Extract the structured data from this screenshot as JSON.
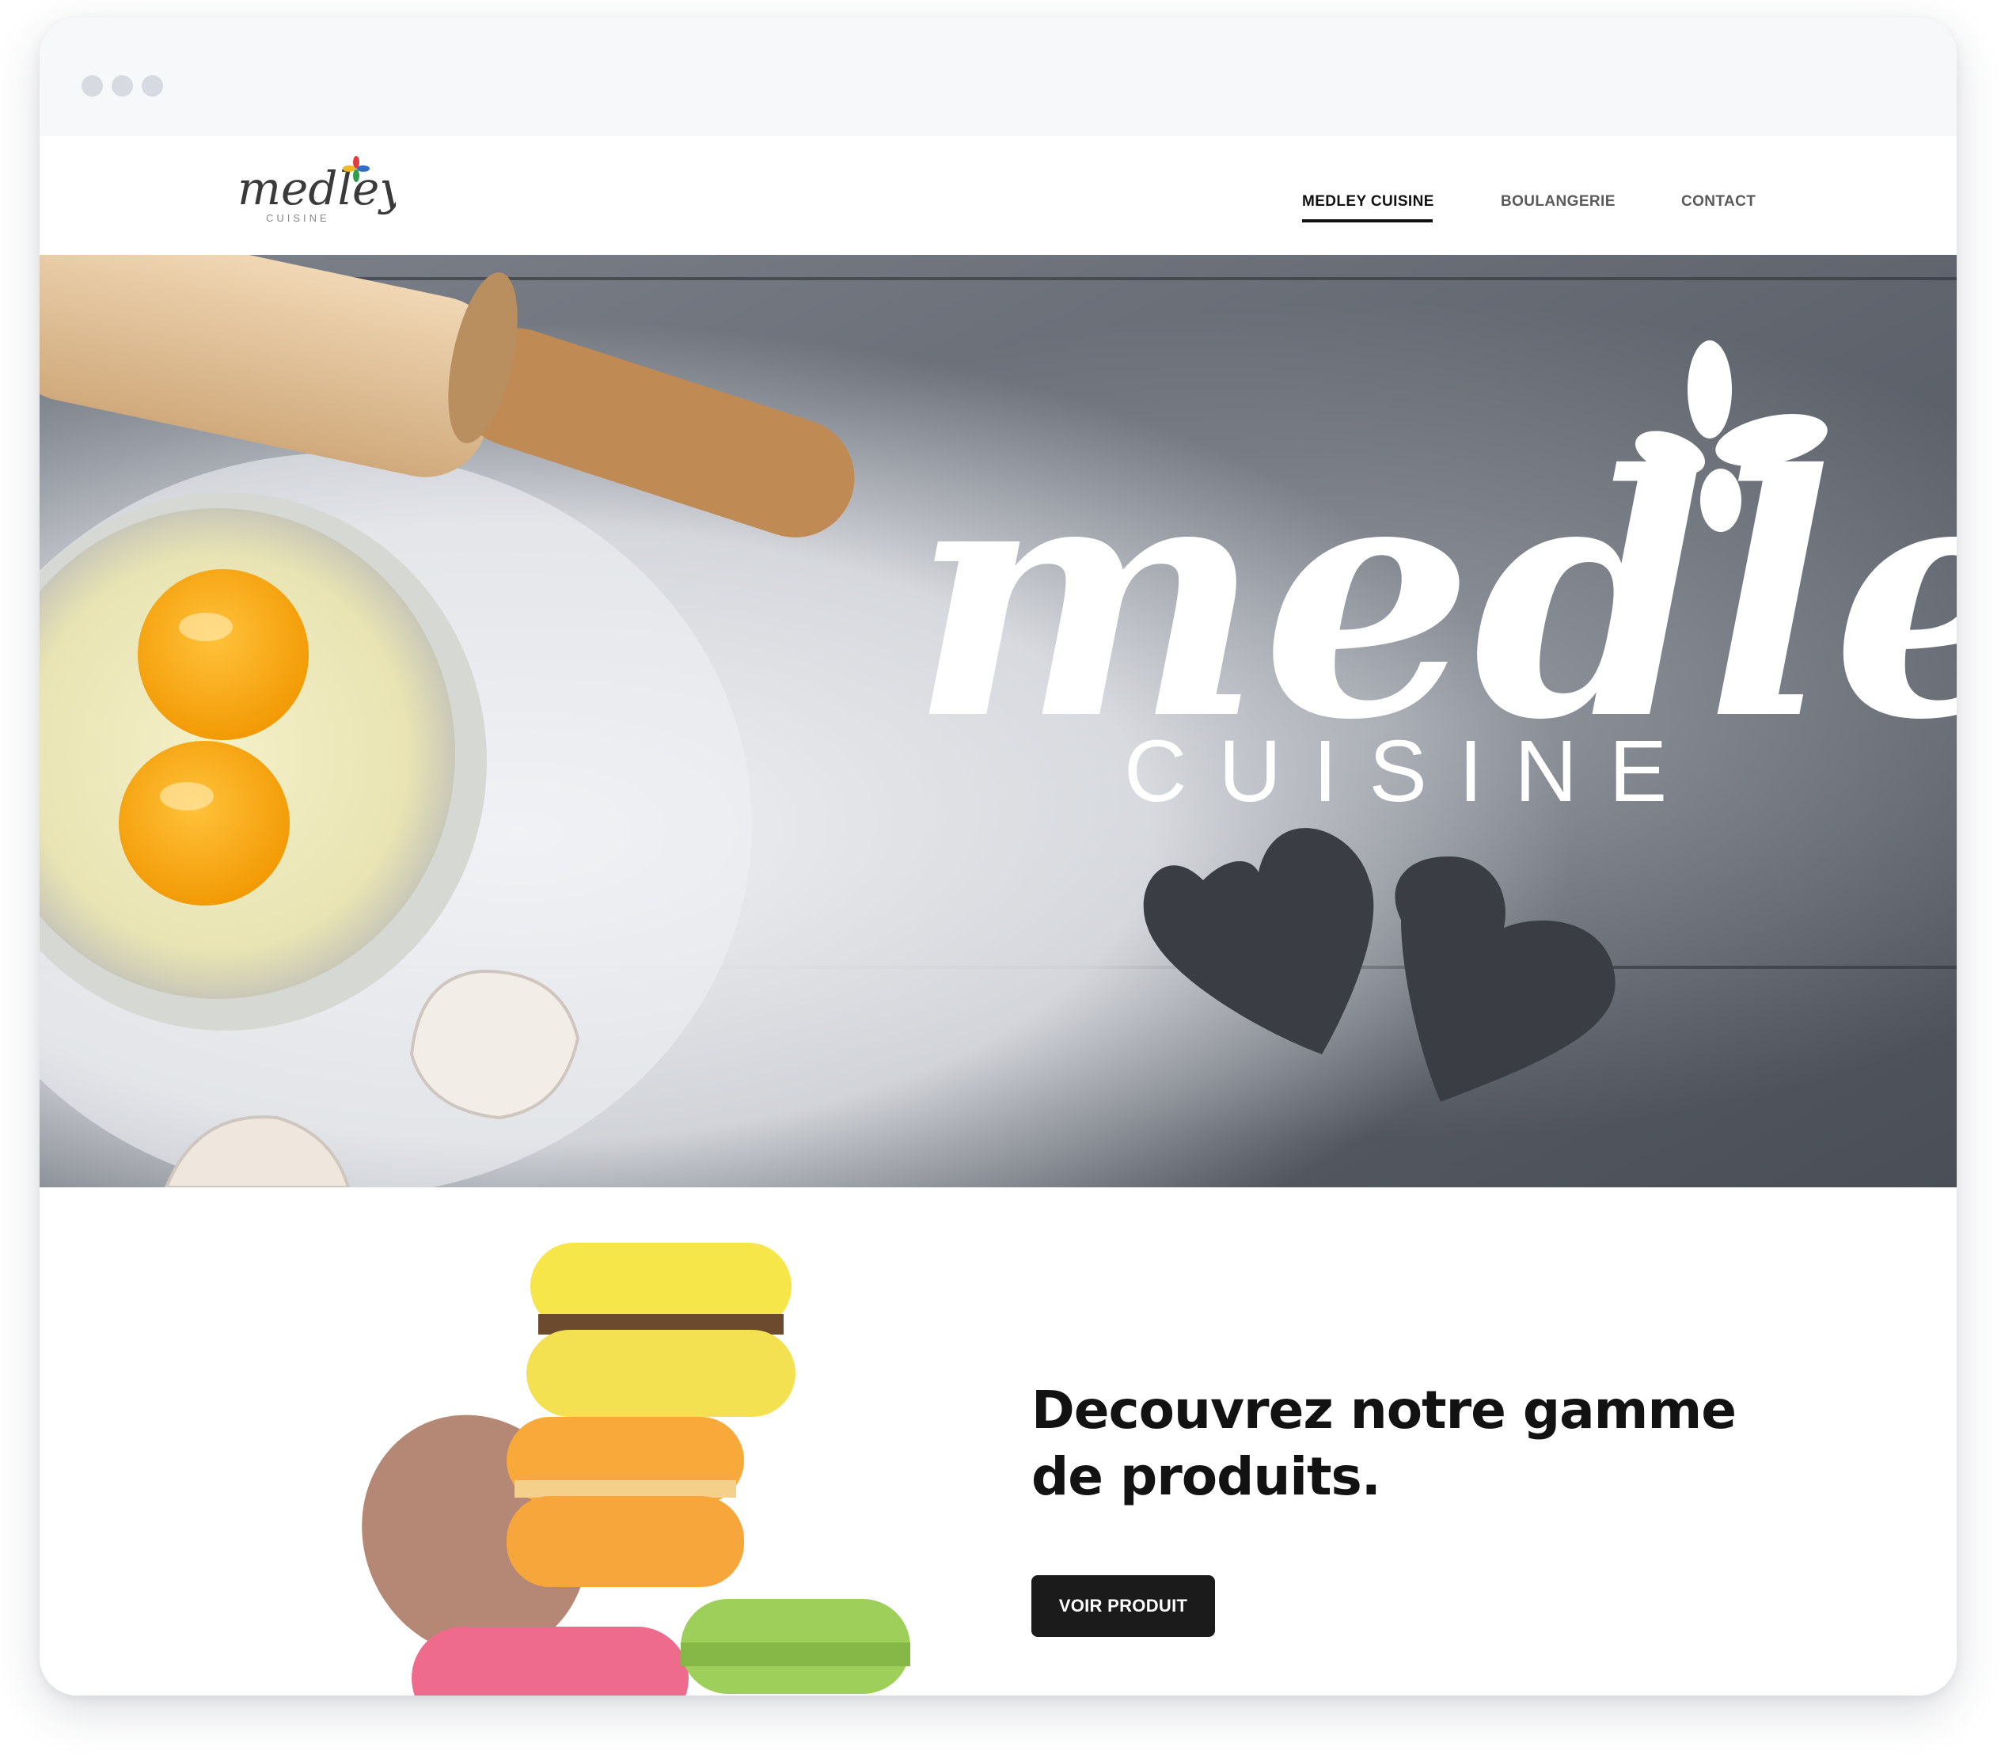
{
  "nav": {
    "logo_text": "medley",
    "logo_subtext": "CUISINE",
    "items": [
      {
        "label": "MEDLEY CUISINE",
        "active": true
      },
      {
        "label": "BOULANGERIE",
        "active": false
      },
      {
        "label": "CONTACT",
        "active": false
      }
    ]
  },
  "hero": {
    "brand_script": "medley",
    "brand_word": "CUISINE"
  },
  "promo": {
    "headline_line1": "Decouvrez notre gamme",
    "headline_line2": "de produits.",
    "button_label": "VOIR PRODUIT"
  },
  "colors": {
    "window_chrome": "#f7f8fa",
    "window_dots": "#d7dae1",
    "text_dark": "#121212",
    "button_bg": "#1b1b1b",
    "hero_board": "#5b6069",
    "flour": "#e9ecf0"
  },
  "icons": [
    "window-dot-icon",
    "flower-icon",
    "heart-icon"
  ]
}
